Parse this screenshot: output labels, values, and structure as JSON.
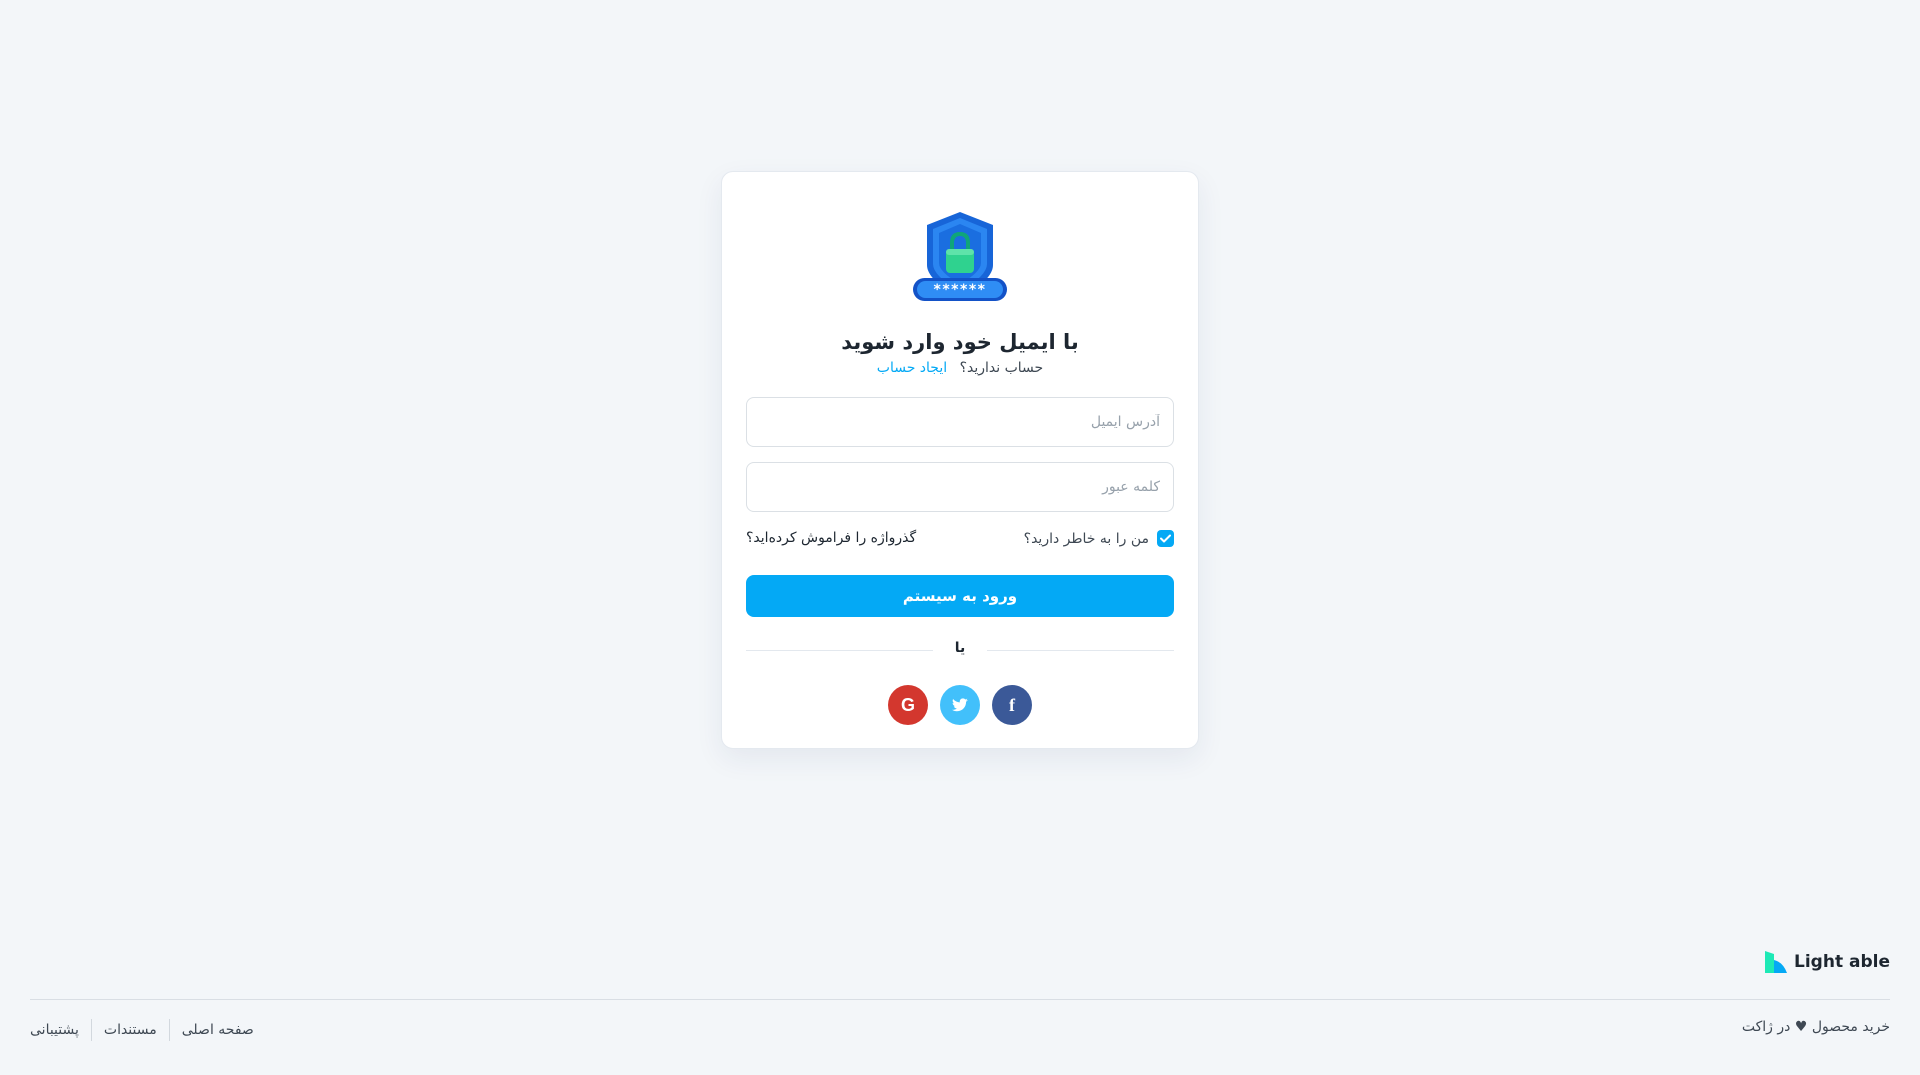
{
  "login": {
    "title": "با ایمیل خود وارد شوید",
    "no_account": "حساب ندارید؟",
    "create_account": "ایجاد حساب",
    "email_placeholder": "آدرس ایمیل",
    "password_placeholder": "کلمه عبور",
    "remember_me": "من را به خاطر دارید؟",
    "remember_checked": true,
    "forgot_password": "گذرواژه را فراموش کرده‌اید؟",
    "submit": "ورود به سیستم",
    "or": "یا",
    "password_mask": "******",
    "social": [
      {
        "name": "google",
        "glyph": "G",
        "color": "#d3372e"
      },
      {
        "name": "twitter",
        "glyph": "twitter-bird",
        "color": "#42c0fb"
      },
      {
        "name": "facebook",
        "glyph": "f",
        "color": "#3b5998"
      }
    ]
  },
  "brand": {
    "name": "Light able"
  },
  "footer": {
    "links": [
      "صفحه اصلی",
      "مستندات",
      "پشتیبانی"
    ],
    "credit": "خرید محصول ♥ در ژاکت"
  },
  "colors": {
    "accent": "#04a9f5",
    "background": "#f3f6f9",
    "brand_green": "#1de9b6"
  }
}
